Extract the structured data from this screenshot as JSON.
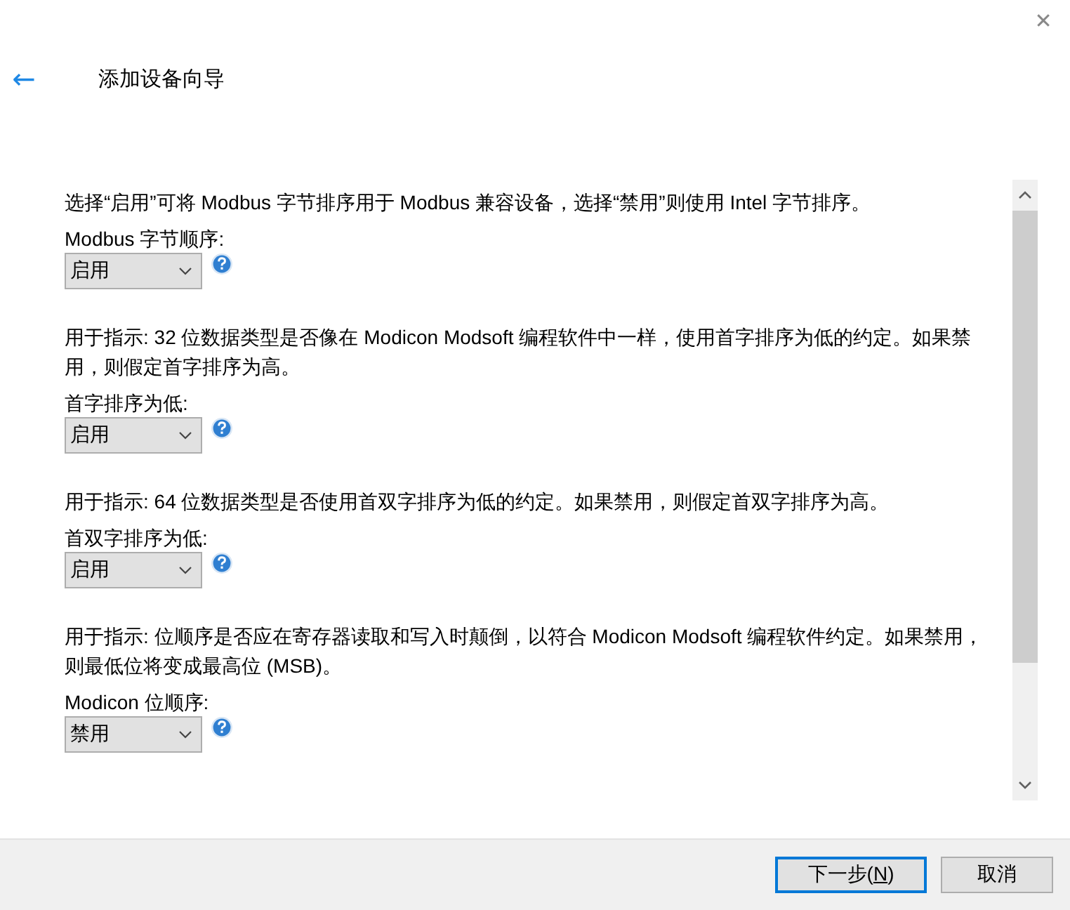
{
  "window": {
    "close": "✕"
  },
  "header": {
    "back": "←",
    "title": "添加设备向导"
  },
  "sections": [
    {
      "description": "选择“启用”可将 Modbus 字节排序用于 Modbus 兼容设备，选择“禁用”则使用 Intel 字节排序。",
      "label": "Modbus 字节顺序:",
      "value": "启用"
    },
    {
      "description": "用于指示: 32 位数据类型是否像在 Modicon Modsoft 编程软件中一样，使用首字排序为低的约定。如果禁用，则假定首字排序为高。",
      "label": "首字排序为低:",
      "value": "启用"
    },
    {
      "description": "用于指示: 64 位数据类型是否使用首双字排序为低的约定。如果禁用，则假定首双字排序为高。",
      "label": "首双字排序为低:",
      "value": "启用"
    },
    {
      "description": "用于指示: 位顺序是否应在寄存器读取和写入时颠倒，以符合 Modicon Modsoft 编程软件约定。如果禁用，则最低位将变成最高位 (MSB)。",
      "label": "Modicon 位顺序:",
      "value": "禁用"
    }
  ],
  "buttons": [
    {
      "before": "下一步(",
      "accelerator": "N",
      "after": ")",
      "default": true
    },
    {
      "before": "取消",
      "default": false
    }
  ]
}
